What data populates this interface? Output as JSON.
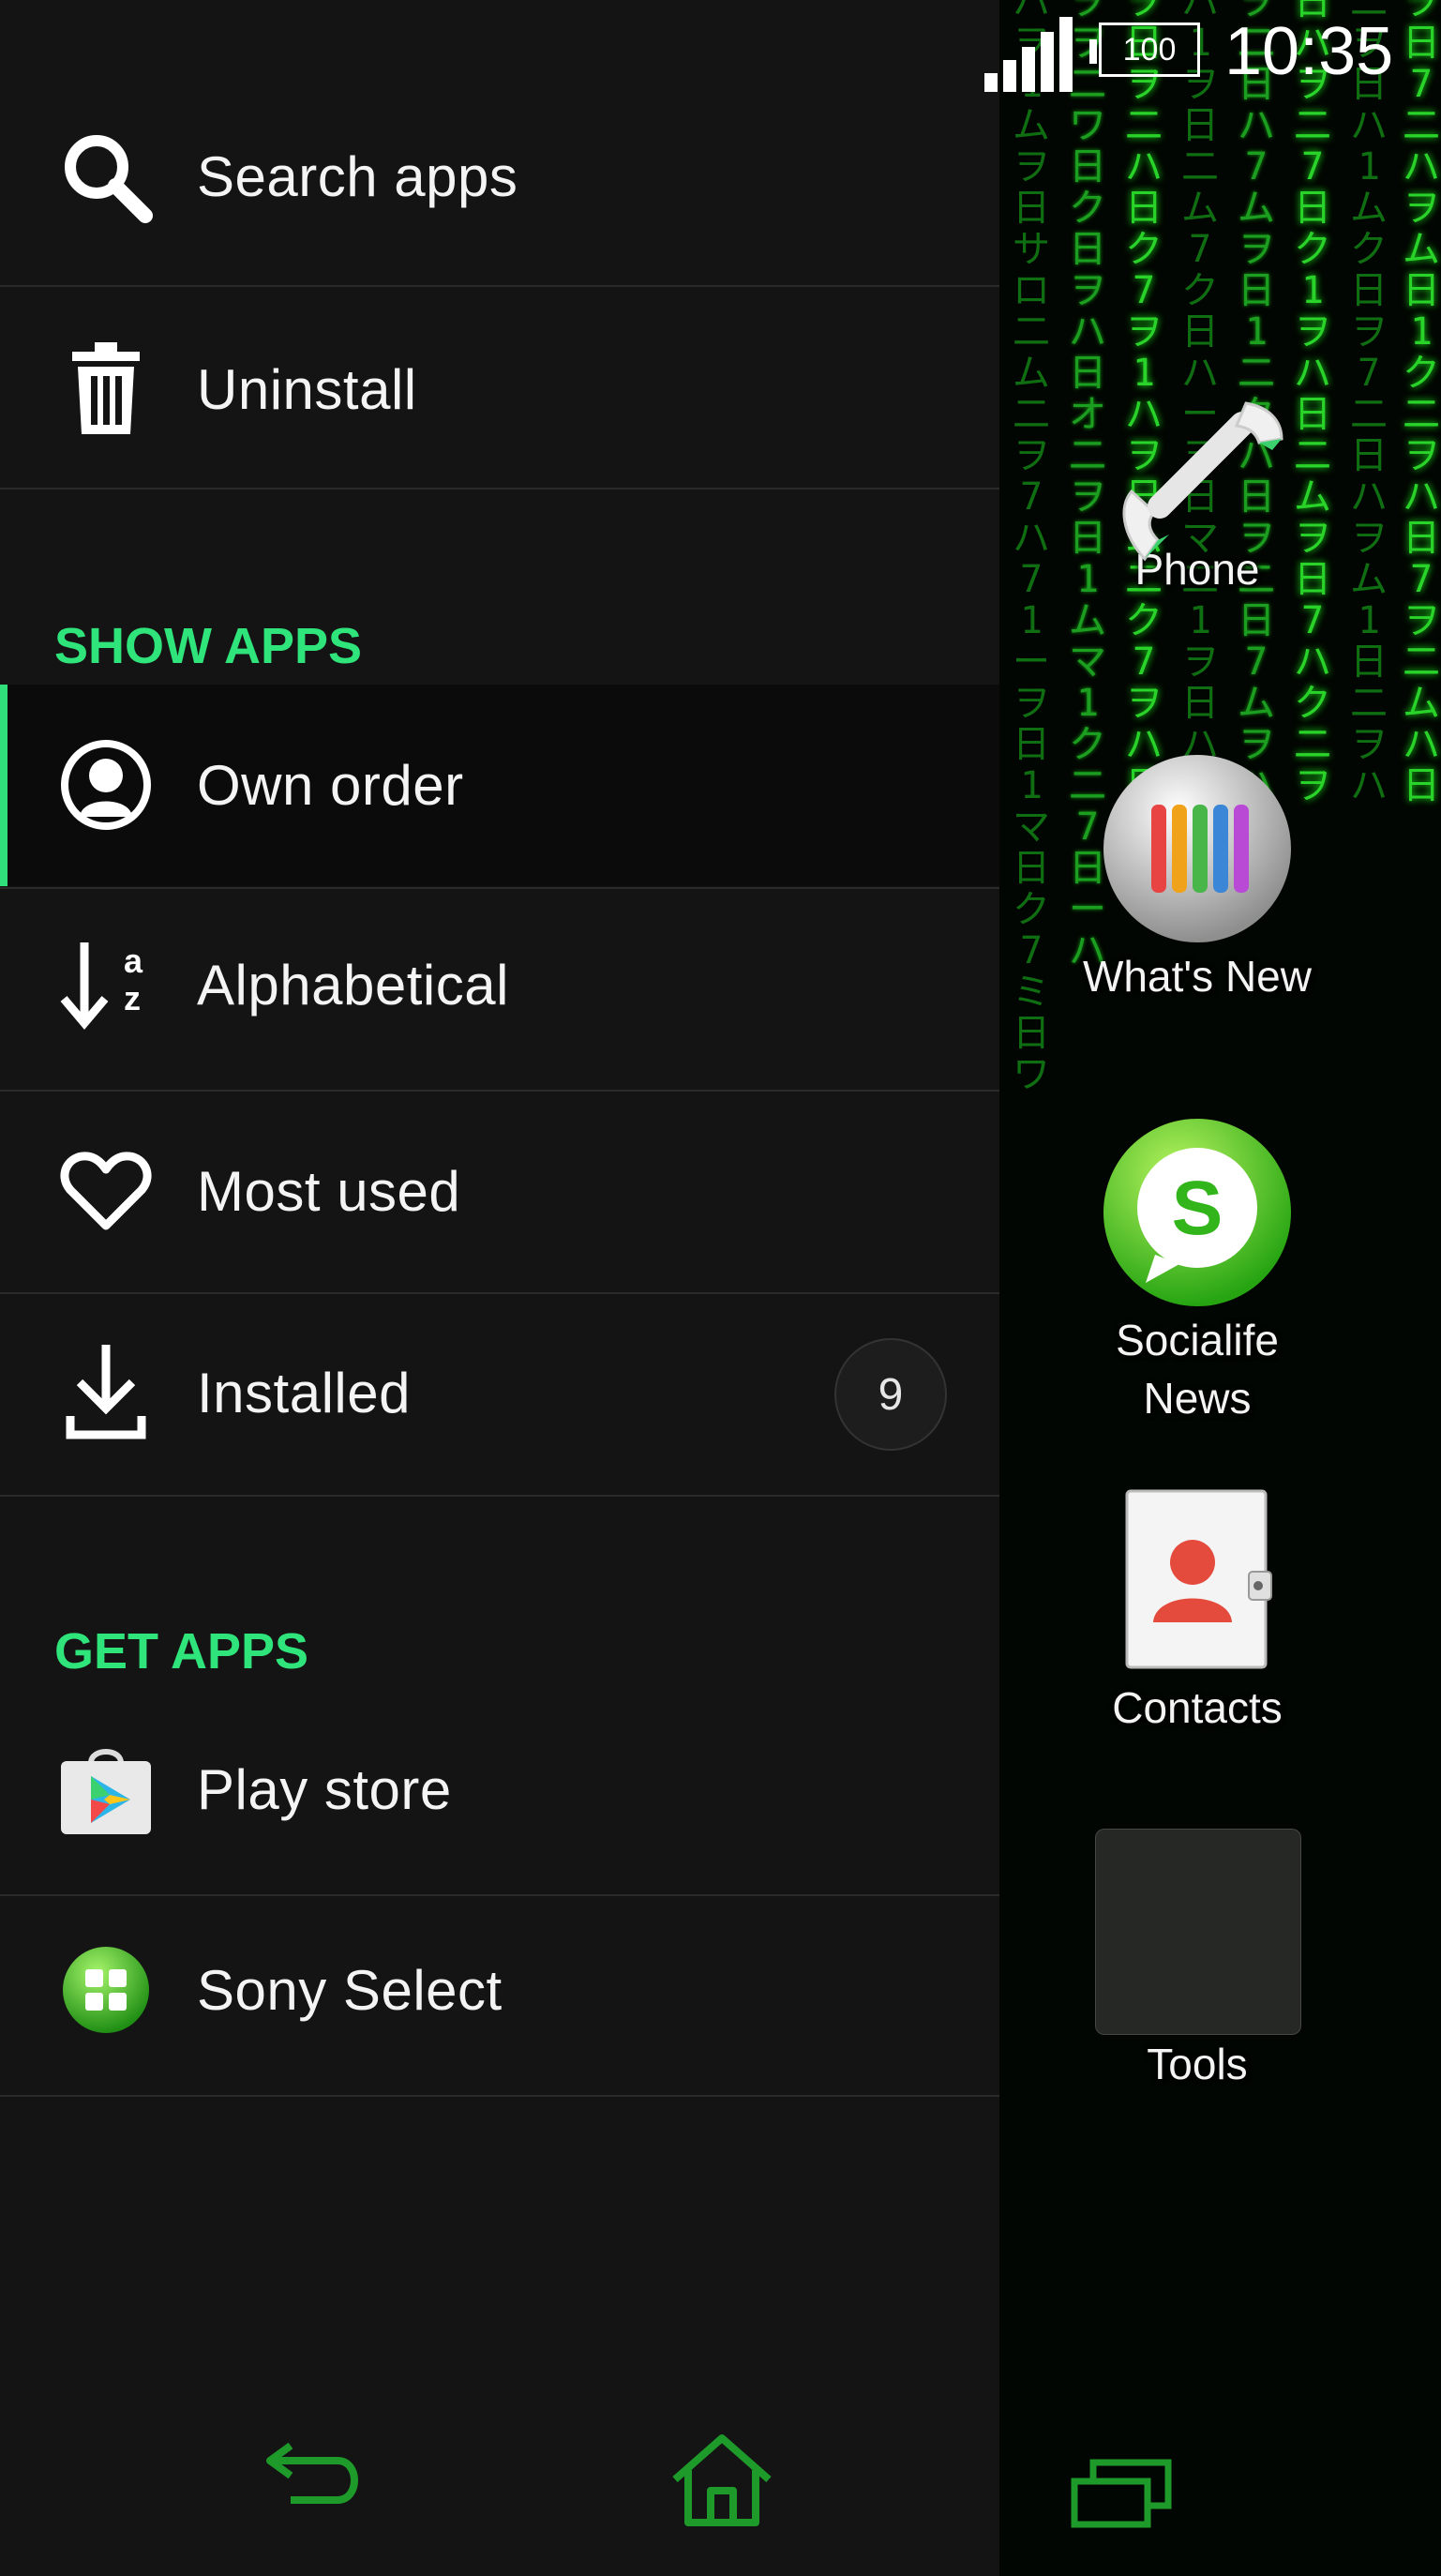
{
  "status": {
    "battery": "100",
    "time": "10:35"
  },
  "drawer": {
    "actions": [
      {
        "label": "Search apps",
        "icon": "search-icon"
      },
      {
        "label": "Uninstall",
        "icon": "trash-icon"
      }
    ],
    "show_apps": {
      "heading": "SHOW APPS",
      "items": [
        {
          "label": "Own order",
          "icon": "person-circle-icon",
          "selected": true
        },
        {
          "label": "Alphabetical",
          "icon": "sort-az-icon"
        },
        {
          "label": "Most used",
          "icon": "heart-icon"
        },
        {
          "label": "Installed",
          "icon": "download-icon",
          "badge": "9"
        }
      ]
    },
    "get_apps": {
      "heading": "GET APPS",
      "items": [
        {
          "label": "Play store",
          "icon": "play-store-icon"
        },
        {
          "label": "Sony Select",
          "icon": "sony-select-icon"
        }
      ]
    }
  },
  "dock": {
    "apps": [
      {
        "label": "Phone",
        "icon": "phone-icon"
      },
      {
        "label": "What's New",
        "icon": "whats-new-icon"
      },
      {
        "label": "Socialife News",
        "icon": "socialife-icon"
      },
      {
        "label": "Contacts",
        "icon": "contacts-icon"
      },
      {
        "label": "Tools",
        "icon": "tools-folder-icon"
      }
    ]
  },
  "navigation": {
    "back": "back-icon",
    "home": "home-icon",
    "recents": "recents-icon"
  },
  "colors": {
    "accent": "#2fe47a",
    "drawer_bg": "#141414",
    "matrix_green": "#2ad32a"
  }
}
